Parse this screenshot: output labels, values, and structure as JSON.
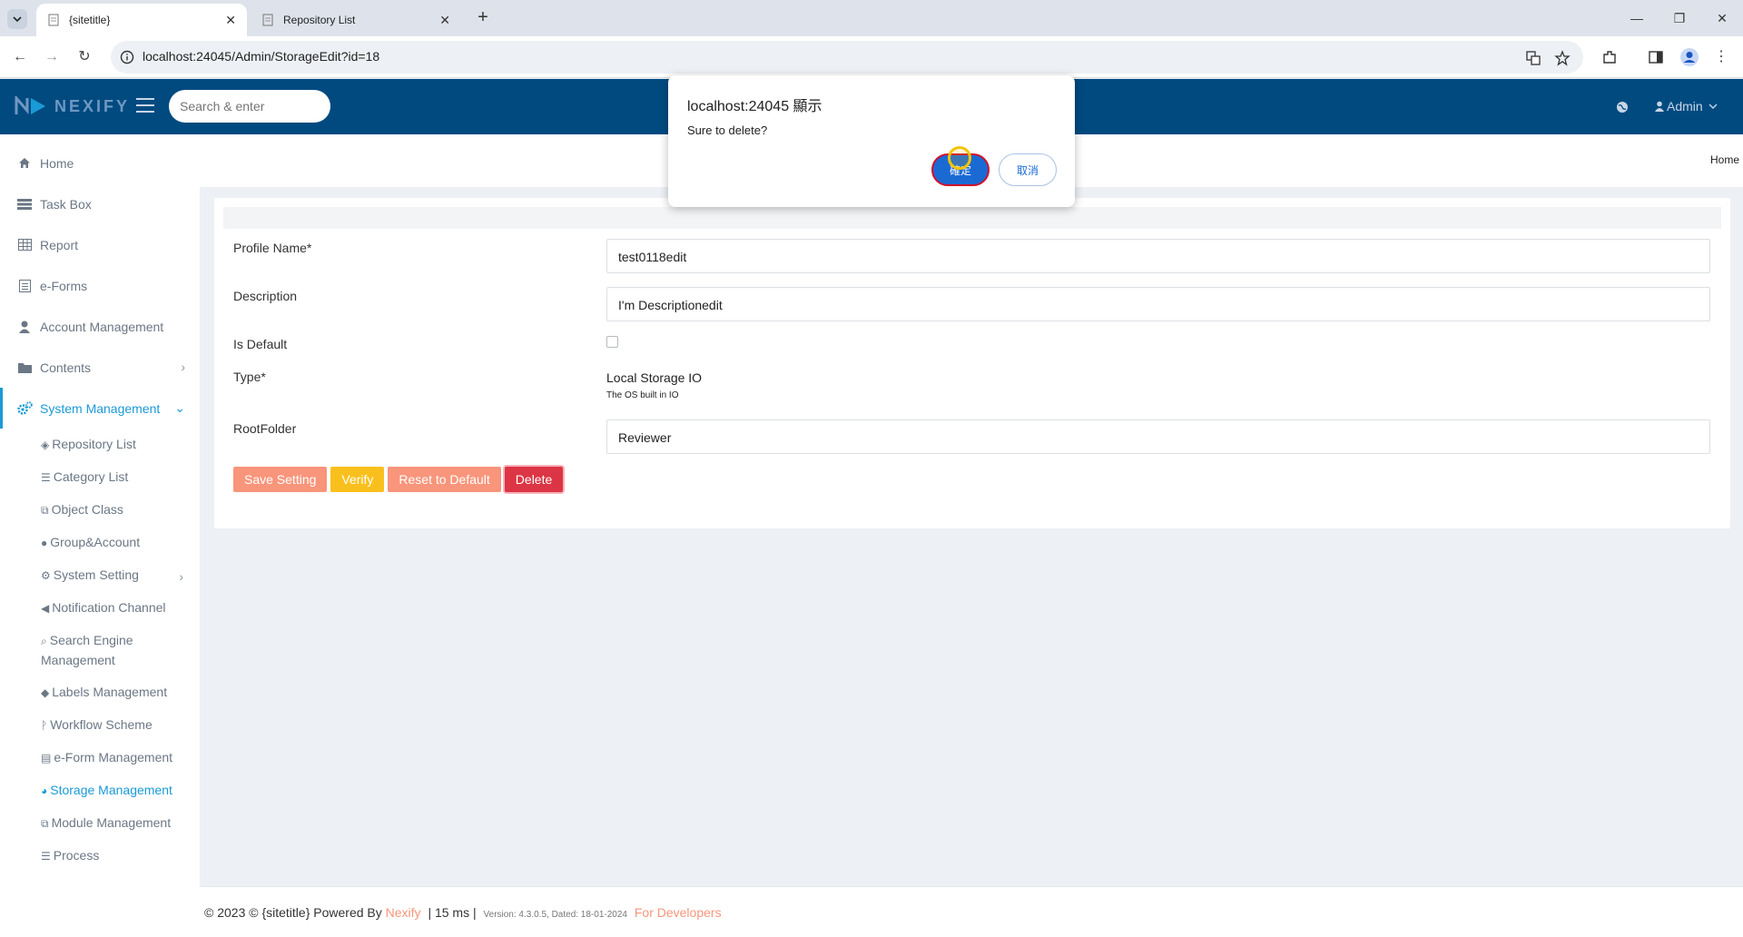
{
  "browser": {
    "tabs": [
      {
        "title": "{sitetitle}",
        "active": true
      },
      {
        "title": "Repository List",
        "active": false
      }
    ],
    "url": "localhost:24045/Admin/StorageEdit?id=18"
  },
  "header": {
    "logo_text": "NEXIFY",
    "search_placeholder": "Search & enter",
    "user_label": "Admin",
    "brand_color": "#004a80"
  },
  "sidebar": {
    "items": [
      {
        "label": "Home",
        "icon": "home-icon"
      },
      {
        "label": "Task Box",
        "icon": "tasks-icon"
      },
      {
        "label": "Report",
        "icon": "table-icon"
      },
      {
        "label": "e-Forms",
        "icon": "form-icon"
      },
      {
        "label": "Account Management",
        "icon": "user-icon"
      },
      {
        "label": "Contents",
        "icon": "folder-icon"
      },
      {
        "label": "System Management",
        "icon": "cogs-icon"
      }
    ],
    "sub_items": [
      {
        "label": "Repository List",
        "icon": "cube-icon"
      },
      {
        "label": "Category List",
        "icon": "list-icon"
      },
      {
        "label": "Object Class",
        "icon": "sitemap-icon"
      },
      {
        "label": "Group&Account",
        "icon": "user-icon"
      },
      {
        "label": "System Setting",
        "icon": "cogs-icon"
      },
      {
        "label": "Notification Channel",
        "icon": "bullhorn-icon"
      },
      {
        "label": "Search Engine Management",
        "icon": "search-icon"
      },
      {
        "label": "Labels Management",
        "icon": "tags-icon"
      },
      {
        "label": "Workflow Scheme",
        "icon": "branch-icon"
      },
      {
        "label": "e-Form Management",
        "icon": "form-icon"
      },
      {
        "label": "Storage Management",
        "icon": "pie-chart-icon"
      },
      {
        "label": "Module Management",
        "icon": "sitemap-icon"
      },
      {
        "label": "Process",
        "icon": "list-icon"
      }
    ],
    "active_color": "#1a9ad6"
  },
  "breadcrumb": {
    "home": "Home"
  },
  "form": {
    "profile_name_label": "Profile Name*",
    "profile_name_value": "test0118edit",
    "description_label": "Description",
    "description_value": "I'm Descriptionedit",
    "is_default_label": "Is Default",
    "is_default_checked": false,
    "type_label": "Type*",
    "type_value": "Local Storage IO",
    "type_description": "The OS built in IO",
    "root_folder_label": "RootFolder",
    "root_folder_value": "Reviewer"
  },
  "buttons": {
    "save": "Save Setting",
    "verify": "Verify",
    "reset": "Reset to Default",
    "delete": "Delete"
  },
  "footer": {
    "copyright": "© 2023 © {sitetitle} Powered By",
    "brand": "Nexify",
    "timing": "| 15 ms |",
    "version": "Version: 4.3.0.5, Dated: 18-01-2024",
    "developers_link": "For Developers"
  },
  "dialog": {
    "title": "localhost:24045 顯示",
    "message": "Sure to delete?",
    "ok_label": "確定",
    "cancel_label": "取消"
  }
}
